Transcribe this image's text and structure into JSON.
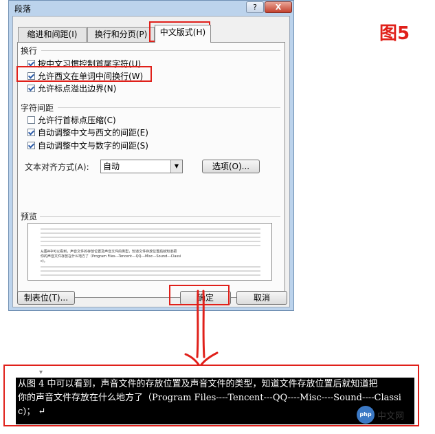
{
  "dialog": {
    "title": "段落",
    "help_glyph": "?",
    "close_glyph": "X",
    "tabs": [
      {
        "label": "缩进和间距(I)",
        "active": false
      },
      {
        "label": "换行和分页(P)",
        "active": false
      },
      {
        "label": "中文版式(H)",
        "active": true
      }
    ],
    "line_break": {
      "heading": "换行",
      "options": [
        {
          "label": "按中文习惯控制首尾字符(U)",
          "checked": true
        },
        {
          "label": "允许西文在单词中间换行(W)",
          "checked": true
        },
        {
          "label": "允许标点溢出边界(N)",
          "checked": true
        }
      ]
    },
    "char_spacing": {
      "heading": "字符间距",
      "options": [
        {
          "label": "允许行首标点压缩(C)",
          "checked": false
        },
        {
          "label": "自动调整中文与西文的间距(E)",
          "checked": true
        },
        {
          "label": "自动调整中文与数字的间距(S)",
          "checked": true
        }
      ]
    },
    "text_align": {
      "label": "文本对齐方式(A):",
      "value": "自动",
      "options_button": "选项(O)..."
    },
    "preview": {
      "heading": "预览",
      "sample_lines": [
        "从图4中可以看到，声音文件的存放位置及声音文件的类型，知道文件存放位置后就知道把",
        "你的声音文件存放在什么地方了（Program    Files---Tencent---QQ---Misc---Sound---Classi",
        "c)。"
      ]
    },
    "tabs_button": "制表位(T)...",
    "ok_button": "确定",
    "cancel_button": "取消"
  },
  "figure_label": "图5",
  "document": {
    "lines": [
      "从图 4 中可以看到，声音文件的存放位置及声音文件的类型，知道文件存放位置后就知道把",
      "你的声音文件存放在什么地方了（Program  Files----Tencent---QQ----Misc----Sound----Classi",
      "c)；"
    ],
    "pilcrow": "↵"
  },
  "watermark": {
    "icon": "php",
    "text": "中文网"
  },
  "colors": {
    "highlight_red": "#e0201a",
    "dialog_frame": "#bcd3ec",
    "dialog_client": "#f0f0f0"
  }
}
